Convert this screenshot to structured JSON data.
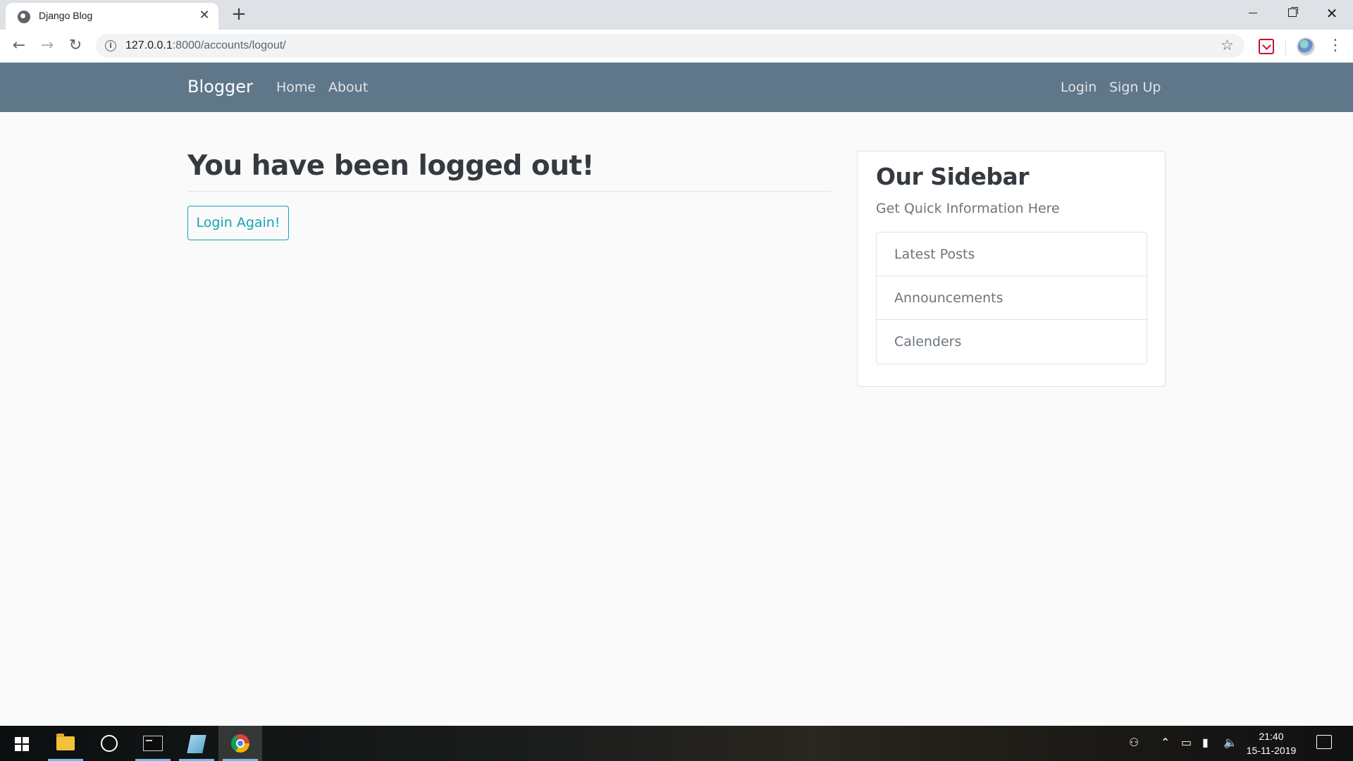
{
  "browser": {
    "tab_title": "Django Blog",
    "tab_close": "✕",
    "new_tab": "+",
    "url_host": "127.0.0.1",
    "url_path": ":8000/accounts/logout/",
    "icons": {
      "back": "←",
      "forward": "→",
      "reload": "↻",
      "info": "i",
      "star": "☆",
      "menu": "⋮",
      "close": "✕"
    }
  },
  "navbar": {
    "brand": "Blogger",
    "left_links": [
      "Home",
      "About"
    ],
    "right_links": [
      "Login",
      "Sign Up"
    ],
    "background": "#607789"
  },
  "main": {
    "heading": "You have been logged out!",
    "button_label": "Login Again!",
    "button_color": "#17a2b8"
  },
  "sidebar": {
    "title": "Our Sidebar",
    "subtitle": "Get Quick Information Here",
    "items": [
      "Latest Posts",
      "Announcements",
      "Calenders"
    ]
  },
  "taskbar": {
    "time": "21:40",
    "date": "15-11-2019",
    "apps": [
      "start",
      "file-explorer",
      "cortana",
      "terminal",
      "notepad",
      "chrome"
    ]
  }
}
